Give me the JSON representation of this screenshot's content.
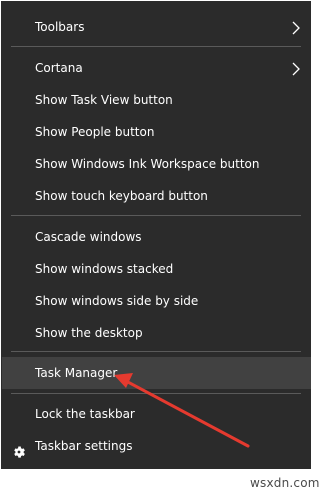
{
  "menu": {
    "toolbars": "Toolbars",
    "cortana": "Cortana",
    "show_task_view": "Show Task View button",
    "show_people": "Show People button",
    "show_ink": "Show Windows Ink Workspace button",
    "show_touch_keyboard": "Show touch keyboard button",
    "cascade": "Cascade windows",
    "stacked": "Show windows stacked",
    "side_by_side": "Show windows side by side",
    "show_desktop": "Show the desktop",
    "task_manager": "Task Manager",
    "lock_taskbar": "Lock the taskbar",
    "taskbar_settings": "Taskbar settings"
  },
  "icons": {
    "submenu": "chevron-right-icon",
    "settings": "gear-icon",
    "annotation": "red-arrow"
  },
  "colors": {
    "menu_bg": "#2b2b2b",
    "hover_bg": "#414141",
    "separator": "#5a5a5a",
    "arrow": "#e53a2f"
  },
  "watermark": "wsxdn.com"
}
